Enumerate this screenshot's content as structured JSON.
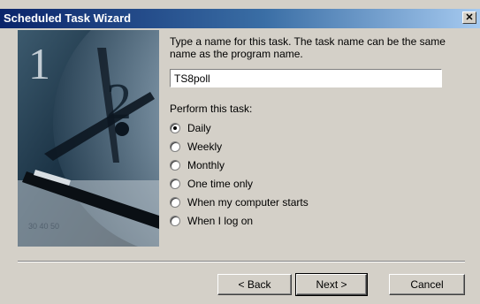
{
  "window": {
    "title": "Scheduled Task Wizard"
  },
  "icons": {
    "close": "close-icon"
  },
  "instruction": "Type a name for this task.  The task name can be the same name as the program name.",
  "task_name": {
    "value": "TS8poll"
  },
  "perform": {
    "label": "Perform this task:",
    "options": [
      "Daily",
      "Weekly",
      "Monthly",
      "One time only",
      "When my computer starts",
      "When I log on"
    ],
    "selected": "Daily"
  },
  "buttons": {
    "back": "< Back",
    "next": "Next >",
    "cancel": "Cancel"
  },
  "colors": {
    "titlebar_start": "#0a246a",
    "titlebar_end": "#a6caf0",
    "dialog_bg": "#d4d0c8"
  }
}
